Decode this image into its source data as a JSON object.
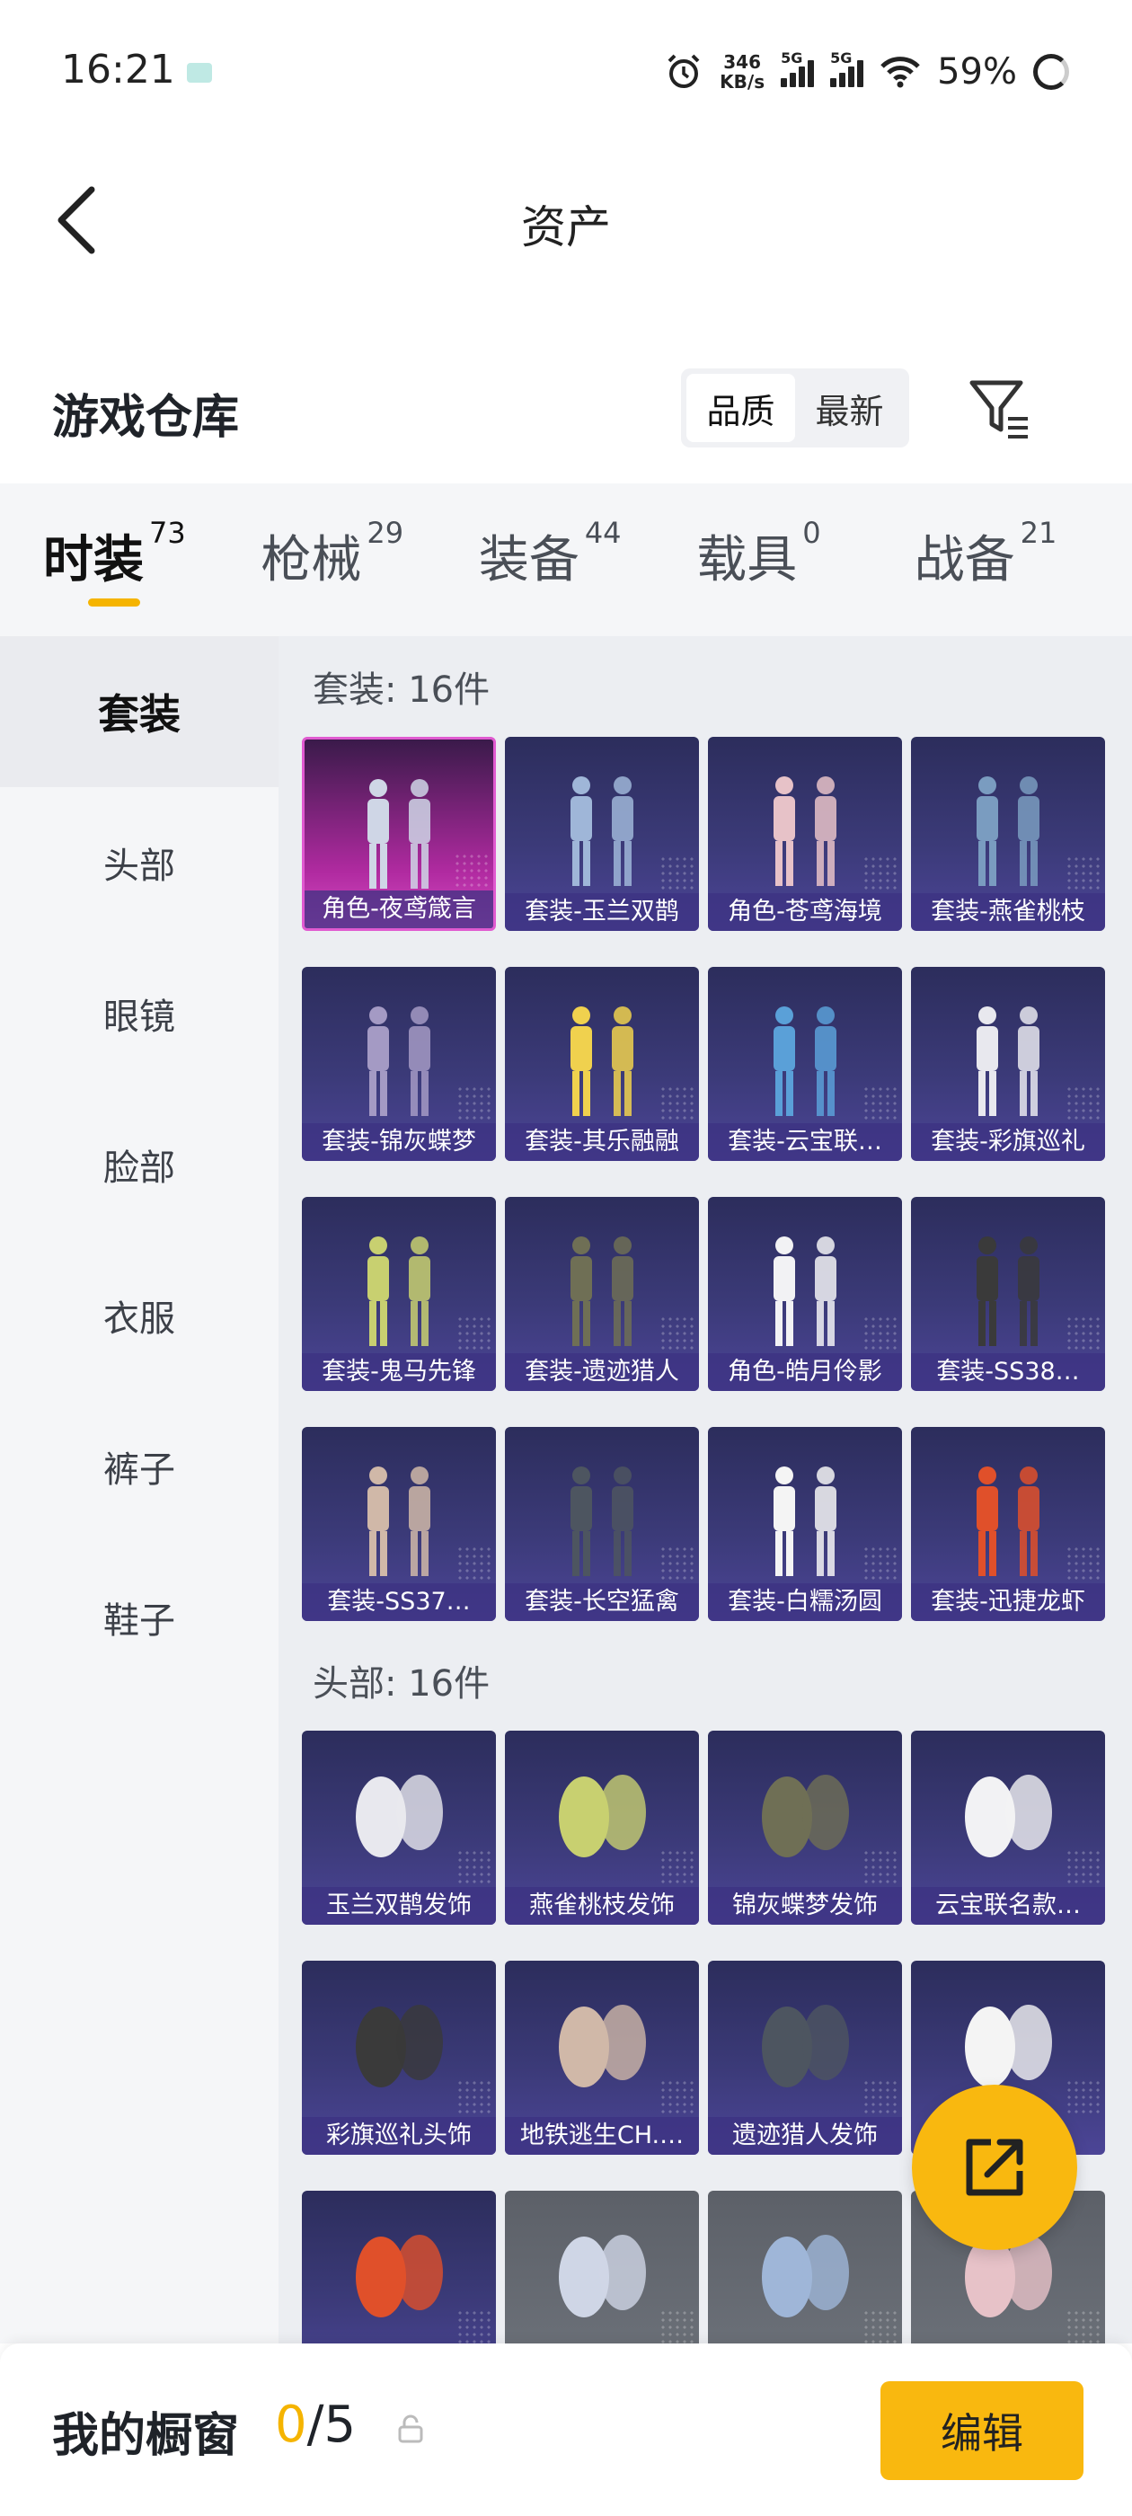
{
  "status_bar": {
    "time": "16:21",
    "speed_value": "346",
    "speed_unit": "KB/s",
    "net1": "5G",
    "net2": "5G",
    "battery": "59%"
  },
  "header": {
    "title": "资产"
  },
  "warehouse": {
    "title": "游戏仓库",
    "sort_options": [
      "品质",
      "最新"
    ],
    "selected_sort": "品质"
  },
  "tabs": [
    {
      "label": "时装",
      "count": "73"
    },
    {
      "label": "枪械",
      "count": "29"
    },
    {
      "label": "装备",
      "count": "44"
    },
    {
      "label": "载具",
      "count": "0"
    },
    {
      "label": "战备",
      "count": "21"
    }
  ],
  "active_tab": "时装",
  "side_menu": [
    "套装",
    "头部",
    "眼镜",
    "脸部",
    "衣服",
    "裤子",
    "鞋子"
  ],
  "active_side": "套装",
  "sections": [
    {
      "title": "套装: 16件",
      "items": [
        "角色-夜鸢箴言",
        "套装-玉兰双鹊",
        "角色-苍鸢海境",
        "套装-燕雀桃枝",
        "套装-锦灰蝶梦",
        "套装-其乐融融",
        "套装-云宝联…",
        "套装-彩旗巡礼",
        "套装-鬼马先锋",
        "套装-遗迹猎人",
        "角色-皓月伶影",
        "套装-SS38…",
        "套装-SS37…",
        "套装-长空猛禽",
        "套装-白糯汤圆",
        "套装-迅捷龙虾"
      ]
    },
    {
      "title": "头部: 16件",
      "items": [
        "玉兰双鹊发饰",
        "燕雀桃枝发饰",
        "锦灰蝶梦发饰",
        "云宝联名款…",
        "彩旗巡礼头饰",
        "地铁逃生CH.…",
        "遗迹猎人发饰",
        "",
        "",
        "",
        "",
        ""
      ]
    }
  ],
  "showcase": {
    "title": "我的橱窗",
    "used": "0",
    "total": "/5",
    "edit_label": "编辑"
  }
}
